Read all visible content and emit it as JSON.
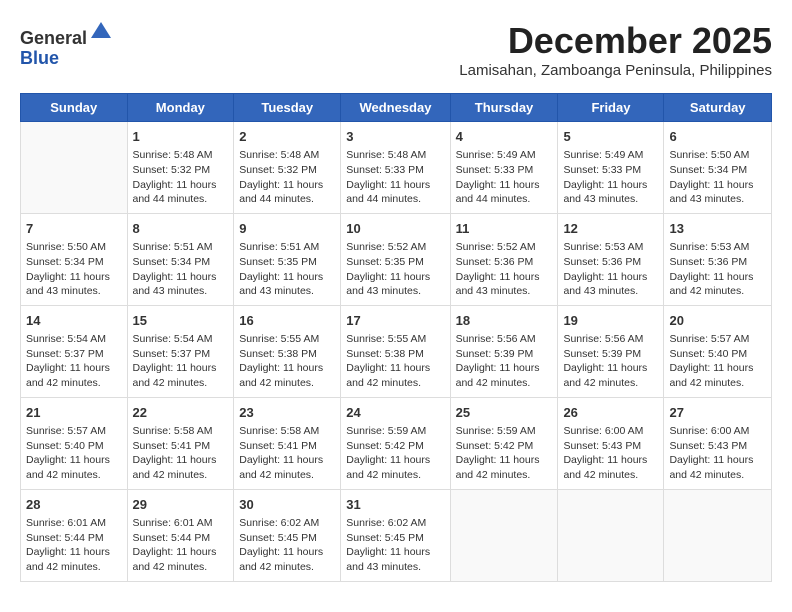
{
  "header": {
    "logo_general": "General",
    "logo_blue": "Blue",
    "month_title": "December 2025",
    "subtitle": "Lamisahan, Zamboanga Peninsula, Philippines"
  },
  "days_of_week": [
    "Sunday",
    "Monday",
    "Tuesday",
    "Wednesday",
    "Thursday",
    "Friday",
    "Saturday"
  ],
  "weeks": [
    [
      {
        "day": "",
        "info": ""
      },
      {
        "day": "1",
        "info": "Sunrise: 5:48 AM\nSunset: 5:32 PM\nDaylight: 11 hours\nand 44 minutes."
      },
      {
        "day": "2",
        "info": "Sunrise: 5:48 AM\nSunset: 5:32 PM\nDaylight: 11 hours\nand 44 minutes."
      },
      {
        "day": "3",
        "info": "Sunrise: 5:48 AM\nSunset: 5:33 PM\nDaylight: 11 hours\nand 44 minutes."
      },
      {
        "day": "4",
        "info": "Sunrise: 5:49 AM\nSunset: 5:33 PM\nDaylight: 11 hours\nand 44 minutes."
      },
      {
        "day": "5",
        "info": "Sunrise: 5:49 AM\nSunset: 5:33 PM\nDaylight: 11 hours\nand 43 minutes."
      },
      {
        "day": "6",
        "info": "Sunrise: 5:50 AM\nSunset: 5:34 PM\nDaylight: 11 hours\nand 43 minutes."
      }
    ],
    [
      {
        "day": "7",
        "info": "Sunrise: 5:50 AM\nSunset: 5:34 PM\nDaylight: 11 hours\nand 43 minutes."
      },
      {
        "day": "8",
        "info": "Sunrise: 5:51 AM\nSunset: 5:34 PM\nDaylight: 11 hours\nand 43 minutes."
      },
      {
        "day": "9",
        "info": "Sunrise: 5:51 AM\nSunset: 5:35 PM\nDaylight: 11 hours\nand 43 minutes."
      },
      {
        "day": "10",
        "info": "Sunrise: 5:52 AM\nSunset: 5:35 PM\nDaylight: 11 hours\nand 43 minutes."
      },
      {
        "day": "11",
        "info": "Sunrise: 5:52 AM\nSunset: 5:36 PM\nDaylight: 11 hours\nand 43 minutes."
      },
      {
        "day": "12",
        "info": "Sunrise: 5:53 AM\nSunset: 5:36 PM\nDaylight: 11 hours\nand 43 minutes."
      },
      {
        "day": "13",
        "info": "Sunrise: 5:53 AM\nSunset: 5:36 PM\nDaylight: 11 hours\nand 42 minutes."
      }
    ],
    [
      {
        "day": "14",
        "info": "Sunrise: 5:54 AM\nSunset: 5:37 PM\nDaylight: 11 hours\nand 42 minutes."
      },
      {
        "day": "15",
        "info": "Sunrise: 5:54 AM\nSunset: 5:37 PM\nDaylight: 11 hours\nand 42 minutes."
      },
      {
        "day": "16",
        "info": "Sunrise: 5:55 AM\nSunset: 5:38 PM\nDaylight: 11 hours\nand 42 minutes."
      },
      {
        "day": "17",
        "info": "Sunrise: 5:55 AM\nSunset: 5:38 PM\nDaylight: 11 hours\nand 42 minutes."
      },
      {
        "day": "18",
        "info": "Sunrise: 5:56 AM\nSunset: 5:39 PM\nDaylight: 11 hours\nand 42 minutes."
      },
      {
        "day": "19",
        "info": "Sunrise: 5:56 AM\nSunset: 5:39 PM\nDaylight: 11 hours\nand 42 minutes."
      },
      {
        "day": "20",
        "info": "Sunrise: 5:57 AM\nSunset: 5:40 PM\nDaylight: 11 hours\nand 42 minutes."
      }
    ],
    [
      {
        "day": "21",
        "info": "Sunrise: 5:57 AM\nSunset: 5:40 PM\nDaylight: 11 hours\nand 42 minutes."
      },
      {
        "day": "22",
        "info": "Sunrise: 5:58 AM\nSunset: 5:41 PM\nDaylight: 11 hours\nand 42 minutes."
      },
      {
        "day": "23",
        "info": "Sunrise: 5:58 AM\nSunset: 5:41 PM\nDaylight: 11 hours\nand 42 minutes."
      },
      {
        "day": "24",
        "info": "Sunrise: 5:59 AM\nSunset: 5:42 PM\nDaylight: 11 hours\nand 42 minutes."
      },
      {
        "day": "25",
        "info": "Sunrise: 5:59 AM\nSunset: 5:42 PM\nDaylight: 11 hours\nand 42 minutes."
      },
      {
        "day": "26",
        "info": "Sunrise: 6:00 AM\nSunset: 5:43 PM\nDaylight: 11 hours\nand 42 minutes."
      },
      {
        "day": "27",
        "info": "Sunrise: 6:00 AM\nSunset: 5:43 PM\nDaylight: 11 hours\nand 42 minutes."
      }
    ],
    [
      {
        "day": "28",
        "info": "Sunrise: 6:01 AM\nSunset: 5:44 PM\nDaylight: 11 hours\nand 42 minutes."
      },
      {
        "day": "29",
        "info": "Sunrise: 6:01 AM\nSunset: 5:44 PM\nDaylight: 11 hours\nand 42 minutes."
      },
      {
        "day": "30",
        "info": "Sunrise: 6:02 AM\nSunset: 5:45 PM\nDaylight: 11 hours\nand 42 minutes."
      },
      {
        "day": "31",
        "info": "Sunrise: 6:02 AM\nSunset: 5:45 PM\nDaylight: 11 hours\nand 43 minutes."
      },
      {
        "day": "",
        "info": ""
      },
      {
        "day": "",
        "info": ""
      },
      {
        "day": "",
        "info": ""
      }
    ]
  ]
}
